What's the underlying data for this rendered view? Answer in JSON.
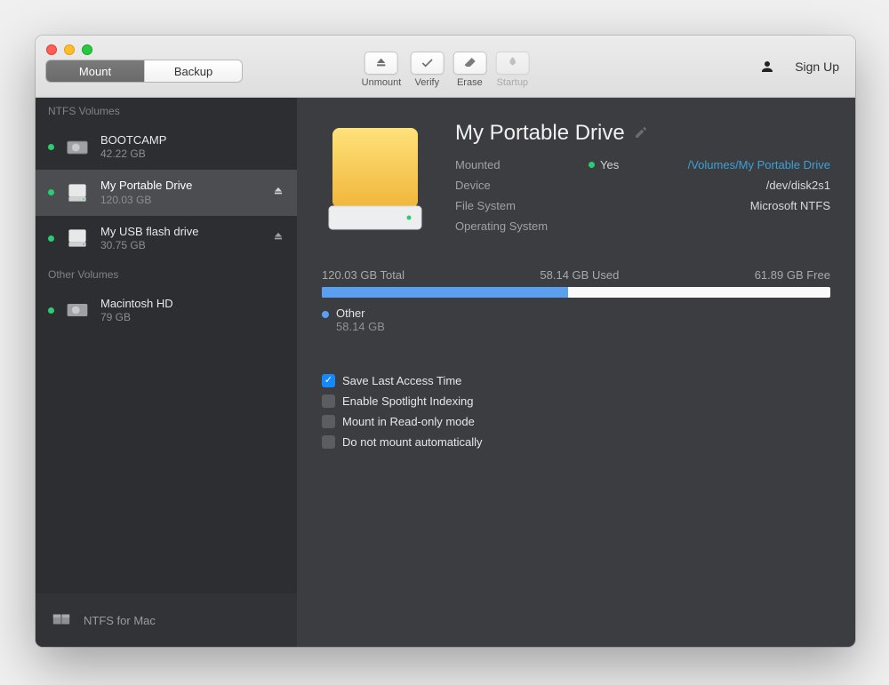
{
  "segmented": {
    "mount": "Mount",
    "backup": "Backup"
  },
  "toolbar": {
    "unmount": "Unmount",
    "verify": "Verify",
    "erase": "Erase",
    "startup": "Startup"
  },
  "header": {
    "signup": "Sign Up"
  },
  "sidebar": {
    "ntfs_header": "NTFS Volumes",
    "other_header": "Other Volumes",
    "items": [
      {
        "name": "BOOTCAMP",
        "size": "42.22 GB"
      },
      {
        "name": "My Portable Drive",
        "size": "120.03 GB"
      },
      {
        "name": "My USB flash drive",
        "size": "30.75 GB"
      }
    ],
    "other_items": [
      {
        "name": "Macintosh HD",
        "size": "79 GB"
      }
    ],
    "footer": "NTFS for Mac"
  },
  "volume": {
    "title": "My Portable Drive",
    "rows": {
      "mounted_k": "Mounted",
      "mounted_yes": "Yes",
      "mounted_path": "/Volumes/My Portable Drive",
      "device_k": "Device",
      "device_v": "/dev/disk2s1",
      "fs_k": "File System",
      "fs_v": "Microsoft NTFS",
      "os_k": "Operating System",
      "os_v": ""
    },
    "usage": {
      "total": "120.03 GB Total",
      "used": "58.14 GB Used",
      "free": "61.89 GB Free",
      "legend_name": "Other",
      "legend_val": "58.14 GB"
    },
    "options": {
      "o1": "Save Last Access Time",
      "o2": "Enable Spotlight Indexing",
      "o3": "Mount in Read-only mode",
      "o4": "Do not mount automatically"
    }
  }
}
